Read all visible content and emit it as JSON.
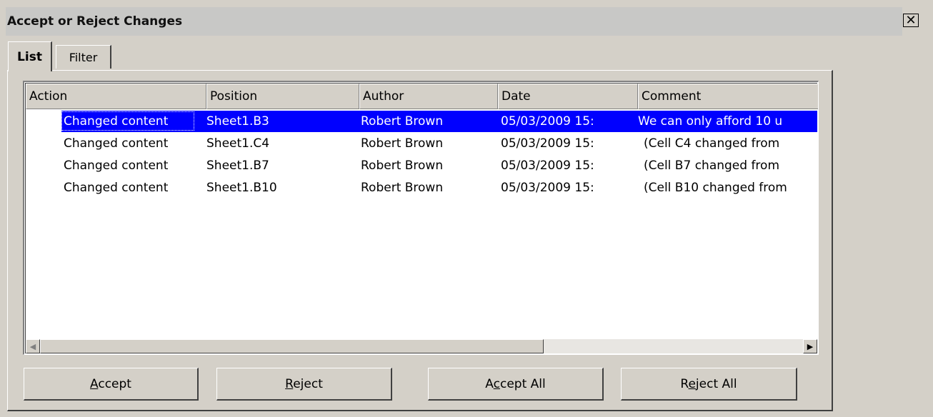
{
  "window": {
    "title": "Accept or Reject Changes",
    "close_symbol": "✕"
  },
  "tabs": [
    {
      "label": "List",
      "active": true
    },
    {
      "label": "Filter",
      "active": false
    }
  ],
  "list": {
    "columns": [
      "Action",
      "Position",
      "Author",
      "Date",
      "Comment"
    ],
    "rows": [
      {
        "action": "Changed content",
        "position": "Sheet1.B3",
        "author": "Robert Brown",
        "date": "05/03/2009 15:",
        "comment": "We can only afford 10 u",
        "selected": true
      },
      {
        "action": "Changed content",
        "position": "Sheet1.C4",
        "author": "Robert Brown",
        "date": "05/03/2009 15:",
        "comment": "(Cell C4 changed from",
        "selected": false
      },
      {
        "action": "Changed content",
        "position": "Sheet1.B7",
        "author": "Robert Brown",
        "date": "05/03/2009 15:",
        "comment": "(Cell B7 changed from",
        "selected": false
      },
      {
        "action": "Changed content",
        "position": "Sheet1.B10",
        "author": "Robert Brown",
        "date": "05/03/2009 15:",
        "comment": "(Cell B10 changed from",
        "selected": false
      }
    ]
  },
  "buttons": {
    "accept": {
      "mnemonic": "A",
      "rest": "ccept"
    },
    "reject": {
      "mnemonic": "R",
      "rest": "eject"
    },
    "accept_all": {
      "pre": "A",
      "mnemonic": "c",
      "rest": "cept All"
    },
    "reject_all": {
      "pre": "R",
      "mnemonic": "e",
      "rest": "ject All"
    }
  },
  "colors": {
    "dialog_bg": "#d4d0c8",
    "selection": "#0000ff",
    "list_bg": "#ffffff"
  }
}
